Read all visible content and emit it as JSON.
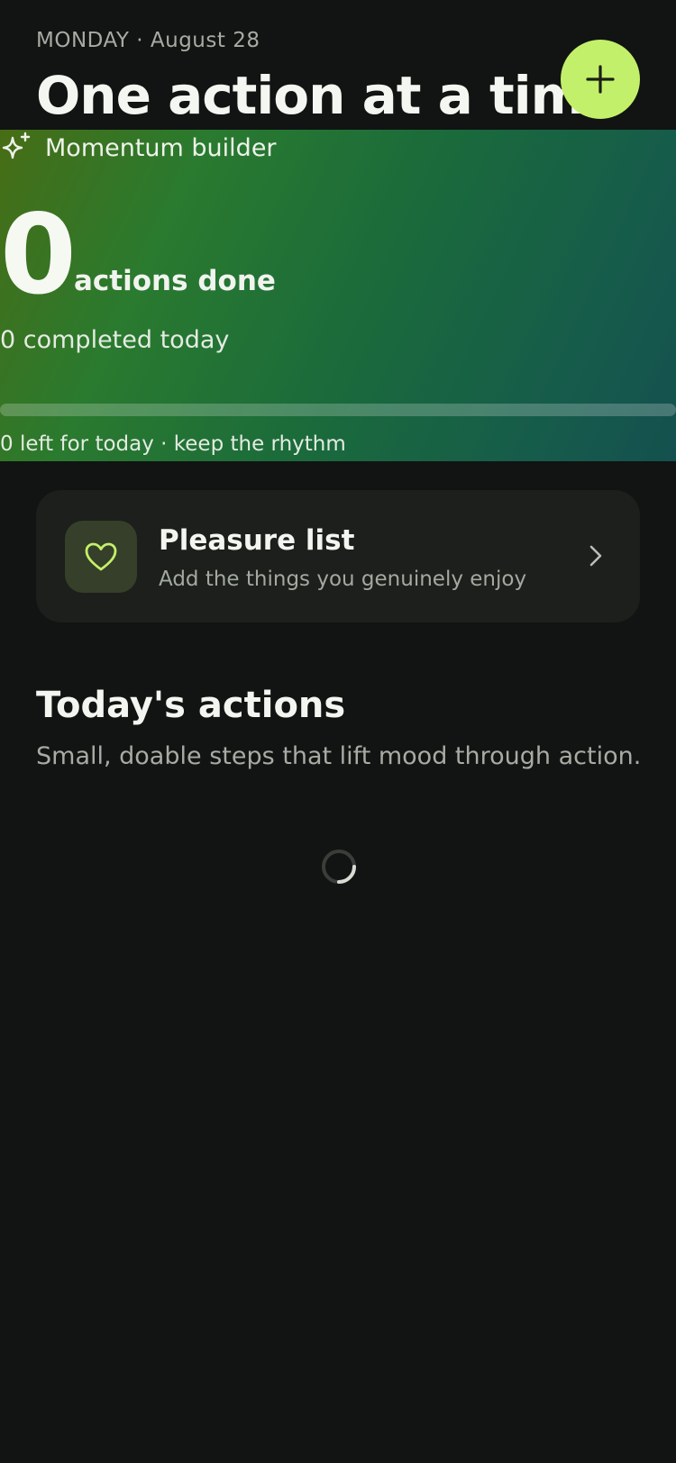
{
  "header": {
    "date_line": "MONDAY · August 28",
    "title": "One action at a time",
    "add_icon": "plus-icon"
  },
  "momentum": {
    "title": "Momentum builder",
    "icon": "sparkles-icon",
    "count": "0",
    "count_label": "actions done",
    "completed_today": "0 completed today",
    "progress_fraction": 0,
    "left_today": "0 left for today · keep the rhythm"
  },
  "pleasure_list": {
    "title": "Pleasure list",
    "subtitle": "Add the things you genuinely enjoy",
    "icon": "heart-icon",
    "chevron": "chevron-right-icon"
  },
  "todays_actions": {
    "title": "Today's actions",
    "subtitle": "Small, doable steps that lift mood through action.",
    "loading_icon": "loading-spinner-icon"
  },
  "colors": {
    "background": "#111412",
    "accent": "#c3f06a",
    "card": "#1c1f1b"
  }
}
